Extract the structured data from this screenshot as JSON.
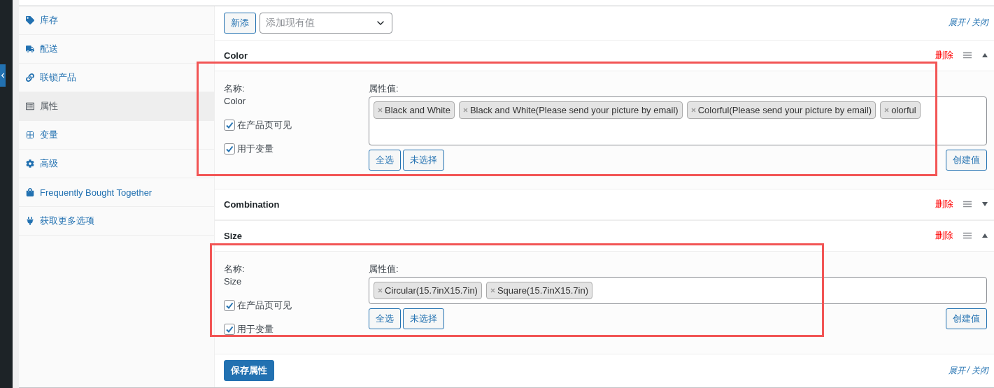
{
  "sidebar": {
    "items": [
      {
        "label": "库存",
        "selected": false
      },
      {
        "label": "配送",
        "selected": false
      },
      {
        "label": "联锁产品",
        "selected": false
      },
      {
        "label": "属性",
        "selected": true
      },
      {
        "label": "变量",
        "selected": false
      },
      {
        "label": "高级",
        "selected": false
      },
      {
        "label": "Frequently Bought Together",
        "selected": false
      },
      {
        "label": "获取更多选项",
        "selected": false
      }
    ]
  },
  "toolbar": {
    "add_button": "新添",
    "select": {
      "placeholder": "添加现有值"
    },
    "expand_link": "展开",
    "separator": "/",
    "close_link": "关闭"
  },
  "attributes": [
    {
      "name": "Color",
      "expanded": true,
      "highlighted": true,
      "delete": "删除",
      "name_label": "名称:",
      "name_value": "Color",
      "values_label": "属性值:",
      "values": [
        "Black and White",
        "Black and White(Please send your picture by email)",
        "Colorful(Please send your picture by email)",
        "olorful"
      ],
      "visible": {
        "label": "在产品页可见",
        "checked": true
      },
      "variation": {
        "label": "用于变量",
        "checked": true
      },
      "select_all": "全选",
      "select_none": "未选择",
      "create_value": "创建值"
    },
    {
      "name": "Combination",
      "expanded": false,
      "delete": "删除"
    },
    {
      "name": "Size",
      "expanded": true,
      "highlighted": true,
      "delete": "删除",
      "name_label": "名称:",
      "name_value": "Size",
      "values_label": "属性值:",
      "values": [
        "Circular(15.7inX15.7in)",
        "Square(15.7inX15.7in)"
      ],
      "visible": {
        "label": "在产品页可见",
        "checked": true
      },
      "variation": {
        "label": "用于变量",
        "checked": true
      },
      "select_all": "全选",
      "select_none": "未选择",
      "create_value": "创建值"
    }
  ],
  "footer": {
    "save_button": "保存属性",
    "expand_link": "展开",
    "separator": "/",
    "close_link": "关闭"
  }
}
